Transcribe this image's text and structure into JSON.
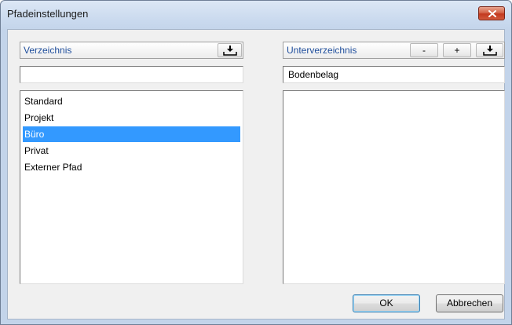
{
  "window": {
    "title": "Pfadeinstellungen"
  },
  "left_panel": {
    "header_label": "Verzeichnis",
    "input_value": "",
    "items": [
      "Standard",
      "Projekt",
      "Büro",
      "Privat",
      "Externer Pfad"
    ],
    "selected_item": "Büro"
  },
  "right_panel": {
    "header_label": "Unterverzeichnis",
    "minus_label": "-",
    "plus_label": "+",
    "input_value": "Bodenbelag",
    "items": []
  },
  "buttons": {
    "ok": "OK",
    "cancel": "Abbrechen"
  },
  "icons": {
    "close": "close-icon",
    "import": "tray-download-icon"
  },
  "colors": {
    "selection": "#3399ff",
    "header_text": "#1f4e9c",
    "close_button": "#c2391f"
  }
}
